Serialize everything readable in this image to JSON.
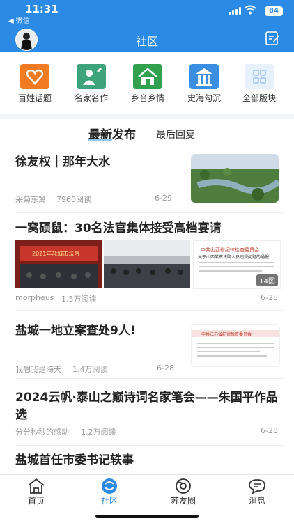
{
  "status": {
    "time": "11:31",
    "back_label": "◀ 微信",
    "battery": "84"
  },
  "header": {
    "title": "社区"
  },
  "categories": [
    {
      "label": "百姓话题",
      "color": "#f07b22"
    },
    {
      "label": "名家名作",
      "color": "#3ea37a"
    },
    {
      "label": "乡音乡情",
      "color": "#31a04f"
    },
    {
      "label": "史海勾沉",
      "color": "#3a8fe2"
    },
    {
      "label": "全部版块",
      "color": "#e7f1fc"
    }
  ],
  "tabs": {
    "latest": "最新发布",
    "reply": "最后回复"
  },
  "posts": [
    {
      "title": "徐友权｜那年大水",
      "author": "采菊东篱",
      "reads": "7960阅读",
      "date": "6-29"
    },
    {
      "title": "一窝硕鼠：30名法官集体接受高档宴请",
      "author": "morpheus",
      "reads": "1.5万阅读",
      "date": "6-28",
      "image_count": "14图",
      "img_banner": "2021年盐城市法院",
      "img_doc_header": "中共山西省纪律检查委员会",
      "img_doc_sub": "关于山西某市法院人员违规问题的通报"
    },
    {
      "title": "盐城一地立案查处9人!",
      "author": "我想我是海天",
      "reads": "1.4万阅读",
      "date": "6-28",
      "img_header": "中共江苏省纪律检查委员会"
    },
    {
      "title": "2024云帆·泰山之巅诗词名家笔会——朱国平作品选",
      "author": "分分秒秒的感动",
      "reads": "1.2万阅读",
      "date": "6-28"
    },
    {
      "title": "盐城首任市委书记轶事"
    }
  ],
  "tabbar": [
    {
      "label": "首页"
    },
    {
      "label": "社区",
      "active": true
    },
    {
      "label": "苏友圈"
    },
    {
      "label": "消息"
    }
  ],
  "colors": {
    "brand": "#2a8ae6",
    "active_tab": "#2a8ae6"
  }
}
